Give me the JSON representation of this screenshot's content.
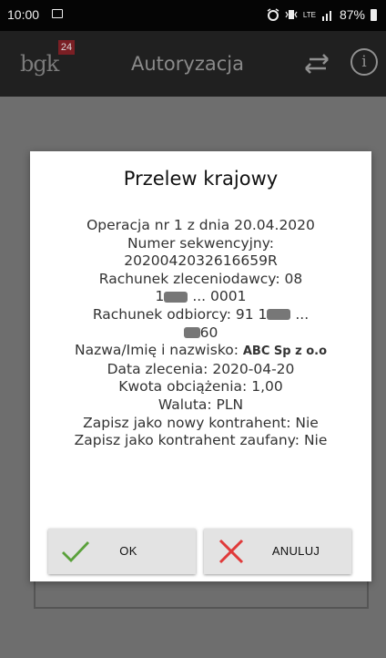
{
  "status_bar": {
    "time": "10:00",
    "network": "LTE",
    "battery": "87%"
  },
  "app_bar": {
    "logo_text": "bgk",
    "logo_badge": "24",
    "title": "Autoryzacja"
  },
  "dialog": {
    "title": "Przelew krajowy",
    "lines": [
      "Operacja nr 1 z dnia 20.04.2020",
      "Numer sekwencyjny:",
      "2020042032616659R",
      "Rachunek zleceniodawcy: 08",
      "1",
      " ... 0001",
      "Rachunek odbiorcy: 91 1",
      " ...",
      "60",
      "Nazwa/Imię i nazwisko: ",
      "ABC Sp z o.o",
      "Data zlecenia: 2020-04-20",
      "Kwota obciążenia: 1,00",
      "Waluta: PLN",
      "Zapisz jako nowy kontrahent: Nie",
      "Zapisz jako kontrahent zaufany: Nie"
    ],
    "ok_label": "OK",
    "cancel_label": "ANULUJ",
    "ok_color": "#5aa13b",
    "cancel_color": "#e03a3a"
  }
}
